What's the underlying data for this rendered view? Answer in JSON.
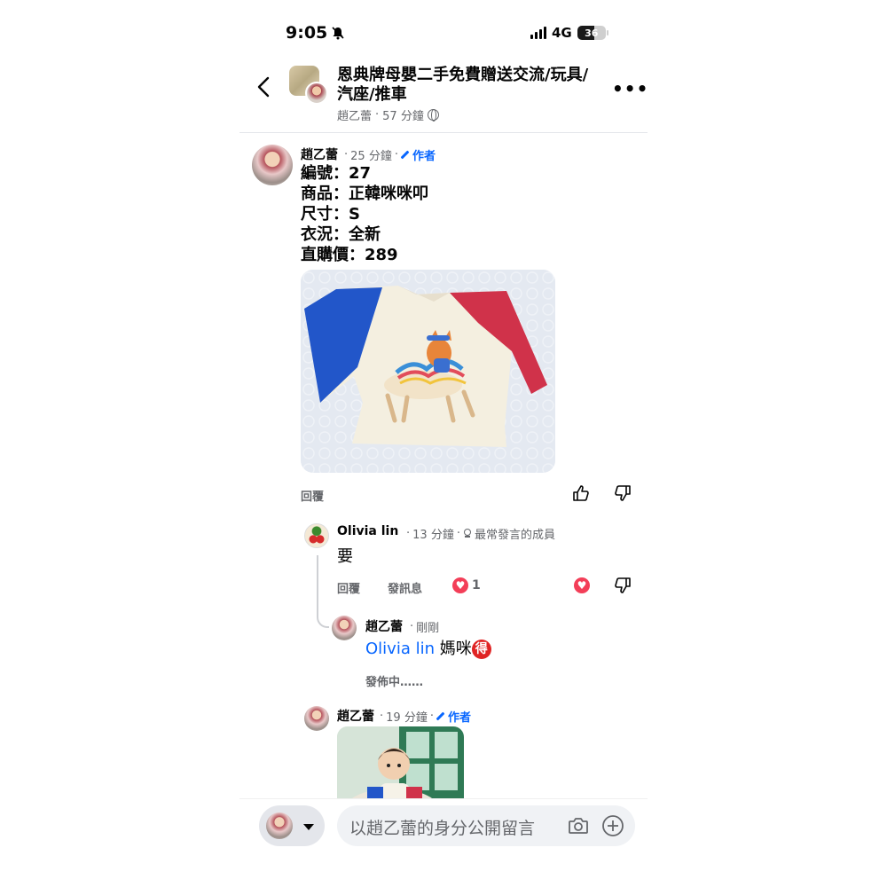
{
  "status_bar": {
    "time": "9:05",
    "network": "4G",
    "battery": "36"
  },
  "header": {
    "title": "恩典牌母嬰二手免費贈送交流/玩具/汽座/推車",
    "author": "趙乙蕾",
    "time": "57 分鐘",
    "separator": "·"
  },
  "comments": {
    "main": {
      "author": "趙乙蕾",
      "time": "25 分鐘",
      "author_badge": "作者",
      "lines": [
        "編號：27",
        "商品：正韓咪咪叩",
        "尺寸：S",
        "衣況：全新",
        "直購價：289"
      ],
      "reply_label": "回覆"
    },
    "olivia": {
      "author": "Olivia lin",
      "time": "13 分鐘",
      "badge": "最常發言的成員",
      "text": "要",
      "reply_label": "回覆",
      "message_label": "發訊息",
      "reaction_count": "1"
    },
    "reply": {
      "author": "趙乙蕾",
      "time": "剛剛",
      "mention": "Olivia lin",
      "text": "媽咪",
      "emoji": "得",
      "status": "發佈中……"
    },
    "second": {
      "author": "趙乙蕾",
      "time": "19 分鐘",
      "author_badge": "作者"
    }
  },
  "composer": {
    "placeholder": "以趙乙蕾的身分公開留言"
  },
  "icons": {
    "back": "chevron-left-icon",
    "more": "more-icon",
    "globe": "globe-icon",
    "like": "thumbs-up-icon",
    "dislike": "thumbs-down-icon",
    "heart": "heart-icon",
    "camera": "camera-icon",
    "add": "plus-circle-icon",
    "pencil": "pencil-icon"
  },
  "colors": {
    "link": "#0866ff",
    "heart": "#f33e58",
    "secondary_text": "#65676b"
  }
}
